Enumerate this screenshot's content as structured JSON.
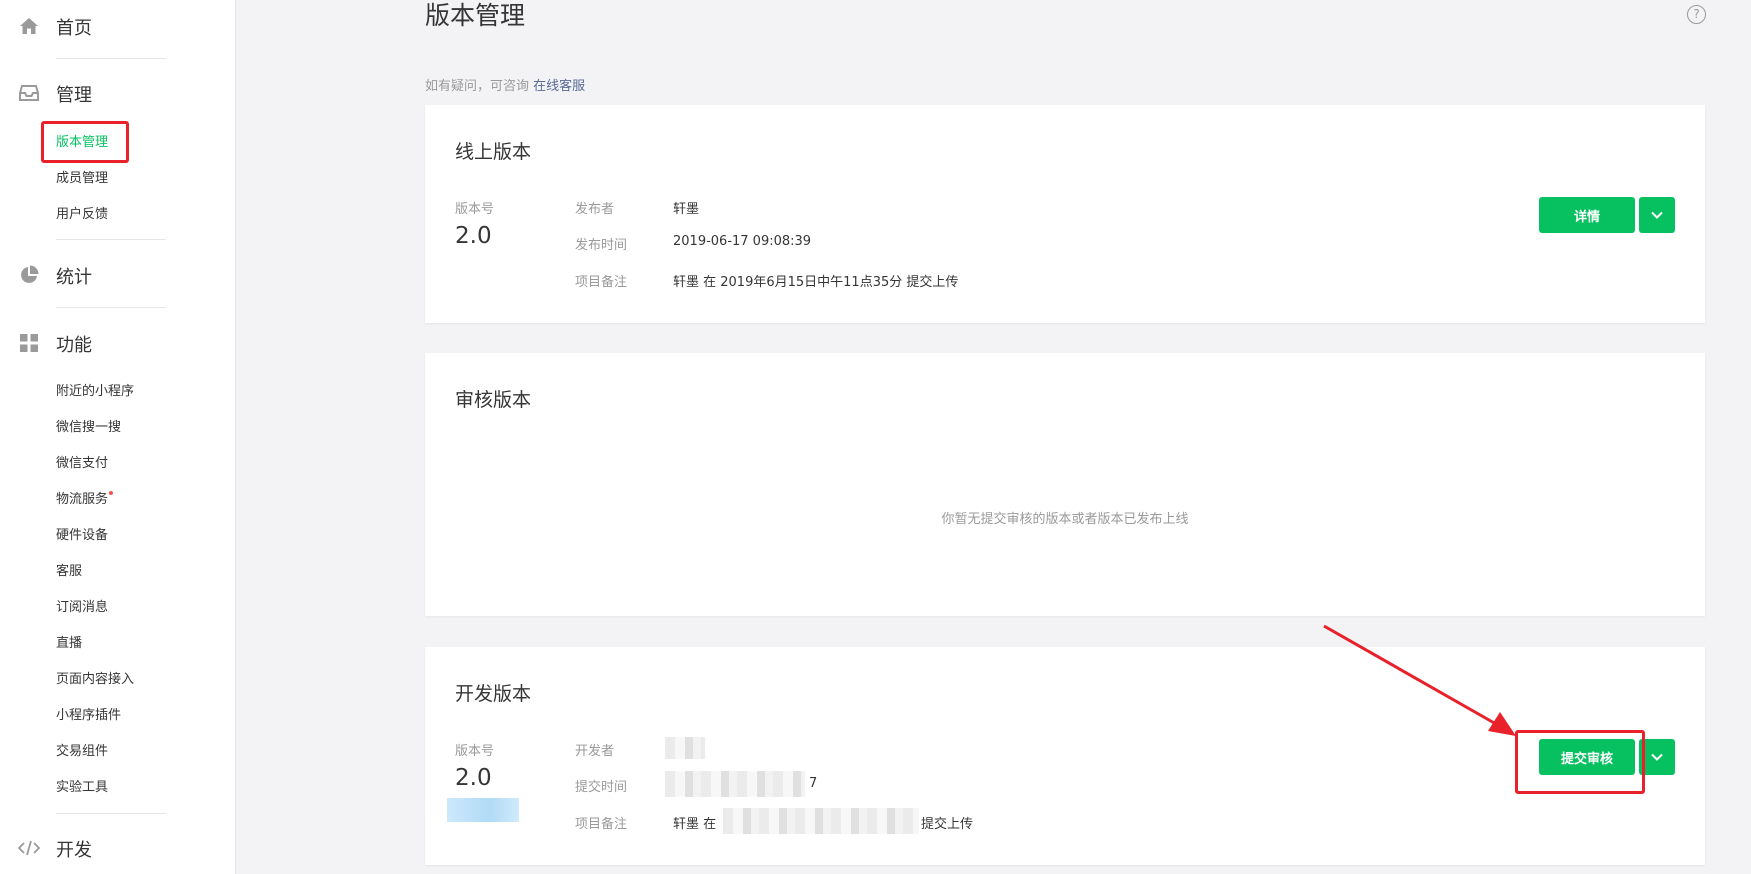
{
  "sidebar": {
    "home": {
      "label": "首页",
      "icon": "home-icon"
    },
    "manage": {
      "label": "管理",
      "icon": "inbox-icon",
      "items": [
        {
          "label": "版本管理",
          "active": true
        },
        {
          "label": "成员管理",
          "active": false
        },
        {
          "label": "用户反馈",
          "active": false
        }
      ]
    },
    "stats": {
      "label": "统计",
      "icon": "pie-chart-icon"
    },
    "features": {
      "label": "功能",
      "icon": "grid-icon",
      "items": [
        {
          "label": "附近的小程序",
          "badge": false
        },
        {
          "label": "微信搜一搜",
          "badge": false
        },
        {
          "label": "微信支付",
          "badge": false
        },
        {
          "label": "物流服务",
          "badge": true
        },
        {
          "label": "硬件设备",
          "badge": false
        },
        {
          "label": "客服",
          "badge": false
        },
        {
          "label": "订阅消息",
          "badge": false
        },
        {
          "label": "直播",
          "badge": false
        },
        {
          "label": "页面内容接入",
          "badge": false
        },
        {
          "label": "小程序插件",
          "badge": false
        },
        {
          "label": "交易组件",
          "badge": false
        },
        {
          "label": "实验工具",
          "badge": false
        }
      ]
    },
    "dev": {
      "label": "开发",
      "icon": "code-icon"
    }
  },
  "header": {
    "title": "版本管理",
    "help_icon": "question-circle-icon",
    "consult_text": "如有疑问，可咨询",
    "consult_link": "在线客服"
  },
  "online": {
    "title": "线上版本",
    "version_label": "版本号",
    "version": "2.0",
    "publisher_key": "发布者",
    "publisher": "轩墨",
    "time_key": "发布时间",
    "time": "2019-06-17 09:08:39",
    "note_key": "项目备注",
    "note": "轩墨 在 2019年6月15日中午11点35分 提交上传",
    "detail_button": "详情"
  },
  "review": {
    "title": "审核版本",
    "empty_hint": "你暂无提交审核的版本或者版本已发布上线"
  },
  "develop": {
    "title": "开发版本",
    "version_label": "版本号",
    "version": "2.0",
    "developer_key": "开发者",
    "time_key": "提交时间",
    "time_tail": "7",
    "note_key": "项目备注",
    "note_prefix": "轩墨 在",
    "note_suffix": "提交上传",
    "submit_button": "提交审核"
  },
  "colors": {
    "brand_green": "#07c160",
    "link_blue": "#576b95",
    "annotation_red": "#e8212a"
  }
}
